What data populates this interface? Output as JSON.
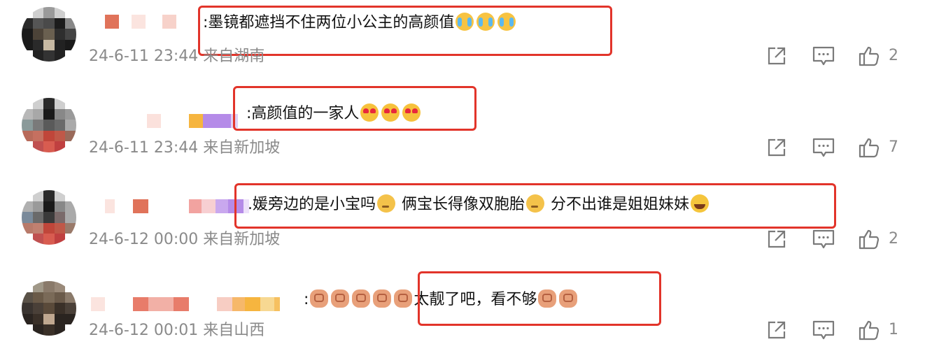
{
  "comments": [
    {
      "text": ":墨镜都遮挡不住两位小公主的高颜值",
      "emojis": [
        "cry-emoji",
        "cry-emoji",
        "cry-emoji"
      ],
      "timestamp": "24-6-11 23:44",
      "location": "来自湖南",
      "likes": "2"
    },
    {
      "text": ":高颜值的一家人",
      "emojis": [
        "heart-eyes-emoji",
        "heart-eyes-emoji",
        "heart-eyes-emoji"
      ],
      "timestamp": "24-6-11 23:44",
      "location": "来自新加坡",
      "likes": "7"
    },
    {
      "text_parts": [
        ".媛旁边的是小宝吗",
        " 俩宝长得像双胞胎",
        " 分不出谁是姐姐妹妹"
      ],
      "timestamp": "24-6-12 00:00",
      "location": "来自新加坡",
      "likes": "2"
    },
    {
      "prefix": ":",
      "text": "太靓了吧，看不够",
      "timestamp": "24-6-12 00:01",
      "location": "来自山西",
      "likes": "1"
    }
  ],
  "icons": {
    "share": "share-icon",
    "reply": "comment-icon",
    "like": "thumbs-up-icon"
  },
  "colors": {
    "highlight_border": "#e2342a",
    "meta_text": "#8a8a8a"
  }
}
